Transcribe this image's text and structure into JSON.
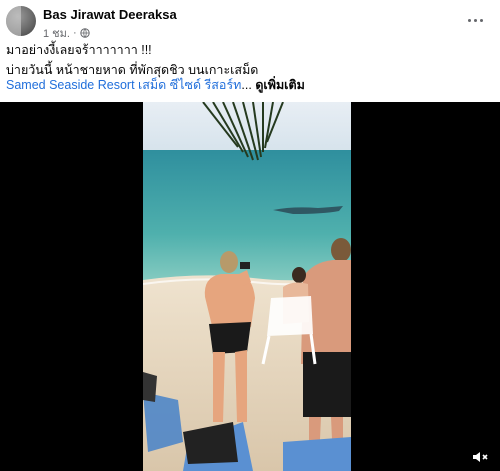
{
  "post": {
    "author": "Bas Jirawat Deeraksa",
    "time": "1 ชม.",
    "separator": "·",
    "privacy_icon": "globe-icon",
    "menu_icon": "more-options-icon",
    "line1": "มาอย่างงี้เลยจร้าาาาาาา !!!",
    "line2": "บ่ายวันนี้ หน้าชายหาด ที่พักสุดชิว บนเกาะเสม็ด",
    "location_link": "Samed Seaside Resort  เสม็ด ซีไซด์ รีสอร์ท",
    "ellipsis": "...",
    "see_more": "ดูเพิ่มเติม"
  },
  "video": {
    "scene": "beach-whale-shark-video",
    "controls_icon": "volume-muted-icon",
    "colors": {
      "sky": "#dfe9f1",
      "sea": "#3f9fa6",
      "sand": "#e6d8c3",
      "background": "#000000"
    }
  }
}
